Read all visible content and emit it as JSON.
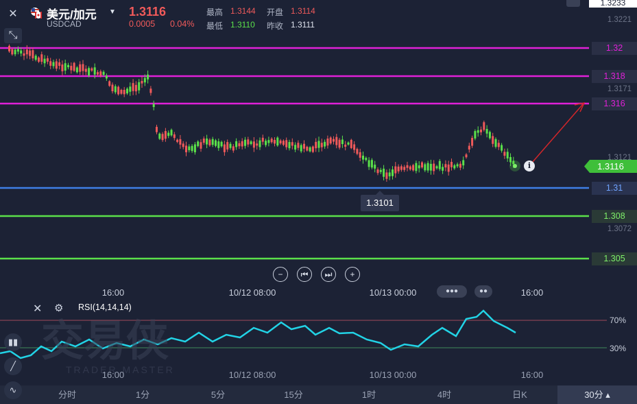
{
  "header": {
    "symbol_name": "美元/加元",
    "symbol_code": "USDCAD",
    "last_price": "1.3116",
    "change": "0.0005",
    "change_percent": "0.04%",
    "high_label": "最高",
    "high_value": "1.3144",
    "open_label": "开盘",
    "open_value": "1.3114",
    "low_label": "最低",
    "low_value": "1.3110",
    "prev_close_label": "昨收",
    "prev_close_value": "1.3111"
  },
  "price_axis": {
    "top_value": "1.3233",
    "labels": [
      "1.3221",
      "1.3171",
      "1.3121",
      "1.3072"
    ],
    "current_price": "1.3116"
  },
  "horizontal_lines": [
    {
      "label": "1.32",
      "color": "#e020d8"
    },
    {
      "label": "1.318",
      "color": "#e020d8"
    },
    {
      "label": "1.316",
      "color": "#e020d8"
    },
    {
      "label": "1.31",
      "color": "#3f7fe6"
    },
    {
      "label": "1.308",
      "color": "#5be14a"
    },
    {
      "label": "1.305",
      "color": "#5be14a"
    }
  ],
  "low_marker": "1.3101",
  "time_axis": [
    "16:00",
    "10/12 08:00",
    "10/13 00:00",
    "16:00"
  ],
  "rsi": {
    "label": "RSI(14,14,14)",
    "level_high": "70%",
    "level_low": "30%"
  },
  "watermark": {
    "cn": "交易侠",
    "en": "TRADER MASTER"
  },
  "timeframes": [
    "分时",
    "1分",
    "5分",
    "15分",
    "1时",
    "4时",
    "日K"
  ],
  "active_timeframe": "30分",
  "colors": {
    "up": "#5be14a",
    "down": "#f05a5a",
    "rsi": "#22d3e6",
    "background": "#1c2235"
  }
}
